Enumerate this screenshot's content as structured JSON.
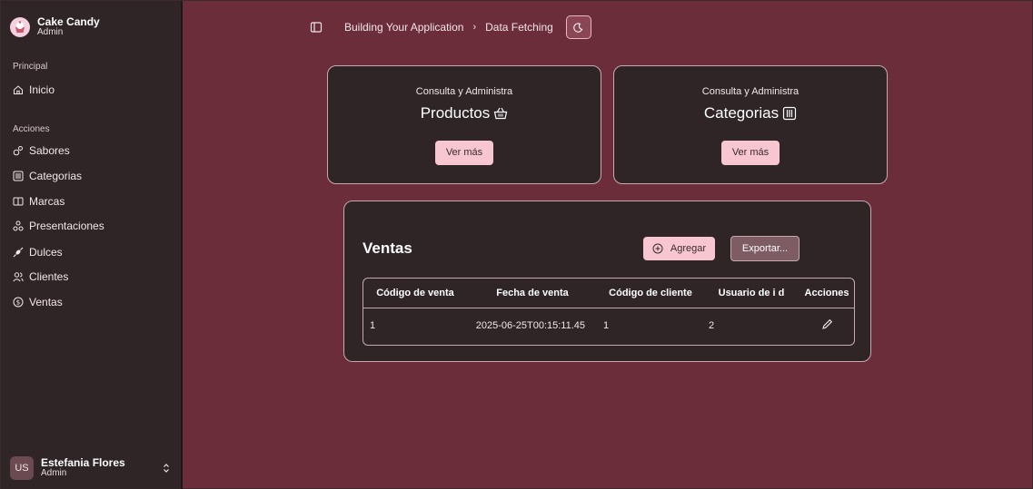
{
  "brand": {
    "name": "Cake Candy",
    "role": "Admin",
    "logo_icon": "cupcake-icon"
  },
  "sidebar": {
    "section_principal": "Principal",
    "section_acciones": "Acciones",
    "items": [
      {
        "label": "Inicio",
        "icon": "home-icon"
      },
      {
        "label": "Sabores",
        "icon": "flavors-icon"
      },
      {
        "label": "Categorias",
        "icon": "columns-icon"
      },
      {
        "label": "Marcas",
        "icon": "brands-icon"
      },
      {
        "label": "Presentaciones",
        "icon": "shapes-icon"
      },
      {
        "label": "Dulces",
        "icon": "candy-icon"
      },
      {
        "label": "Clientes",
        "icon": "users-icon"
      },
      {
        "label": "Ventas",
        "icon": "dollar-icon"
      }
    ]
  },
  "user": {
    "initials": "US",
    "name": "Estefania Flores",
    "role": "Admin"
  },
  "topbar": {
    "breadcrumb": [
      "Building Your Application",
      "Data Fetching"
    ],
    "separator": "›"
  },
  "cards": [
    {
      "subtitle": "Consulta y Administra",
      "title": "Productos",
      "icon": "basket-icon",
      "button": "Ver más"
    },
    {
      "subtitle": "Consulta y Administra",
      "title": "Categorias",
      "icon": "columns-icon",
      "button": "Ver más"
    }
  ],
  "ventas": {
    "title": "Ventas",
    "add_label": "Agregar",
    "export_label": "Exportar...",
    "columns": [
      "Código de venta",
      "Fecha de venta",
      "Código de cliente",
      "Usuario de i d",
      "Acciones"
    ],
    "rows": [
      [
        "1",
        "2025-06-25T00:15:11.45",
        "1",
        "2"
      ]
    ]
  },
  "colors": {
    "background": "#6b2d3a",
    "sidebar": "#2f2527",
    "card": "#2f2527",
    "accent_pink": "#f8c6d0"
  }
}
